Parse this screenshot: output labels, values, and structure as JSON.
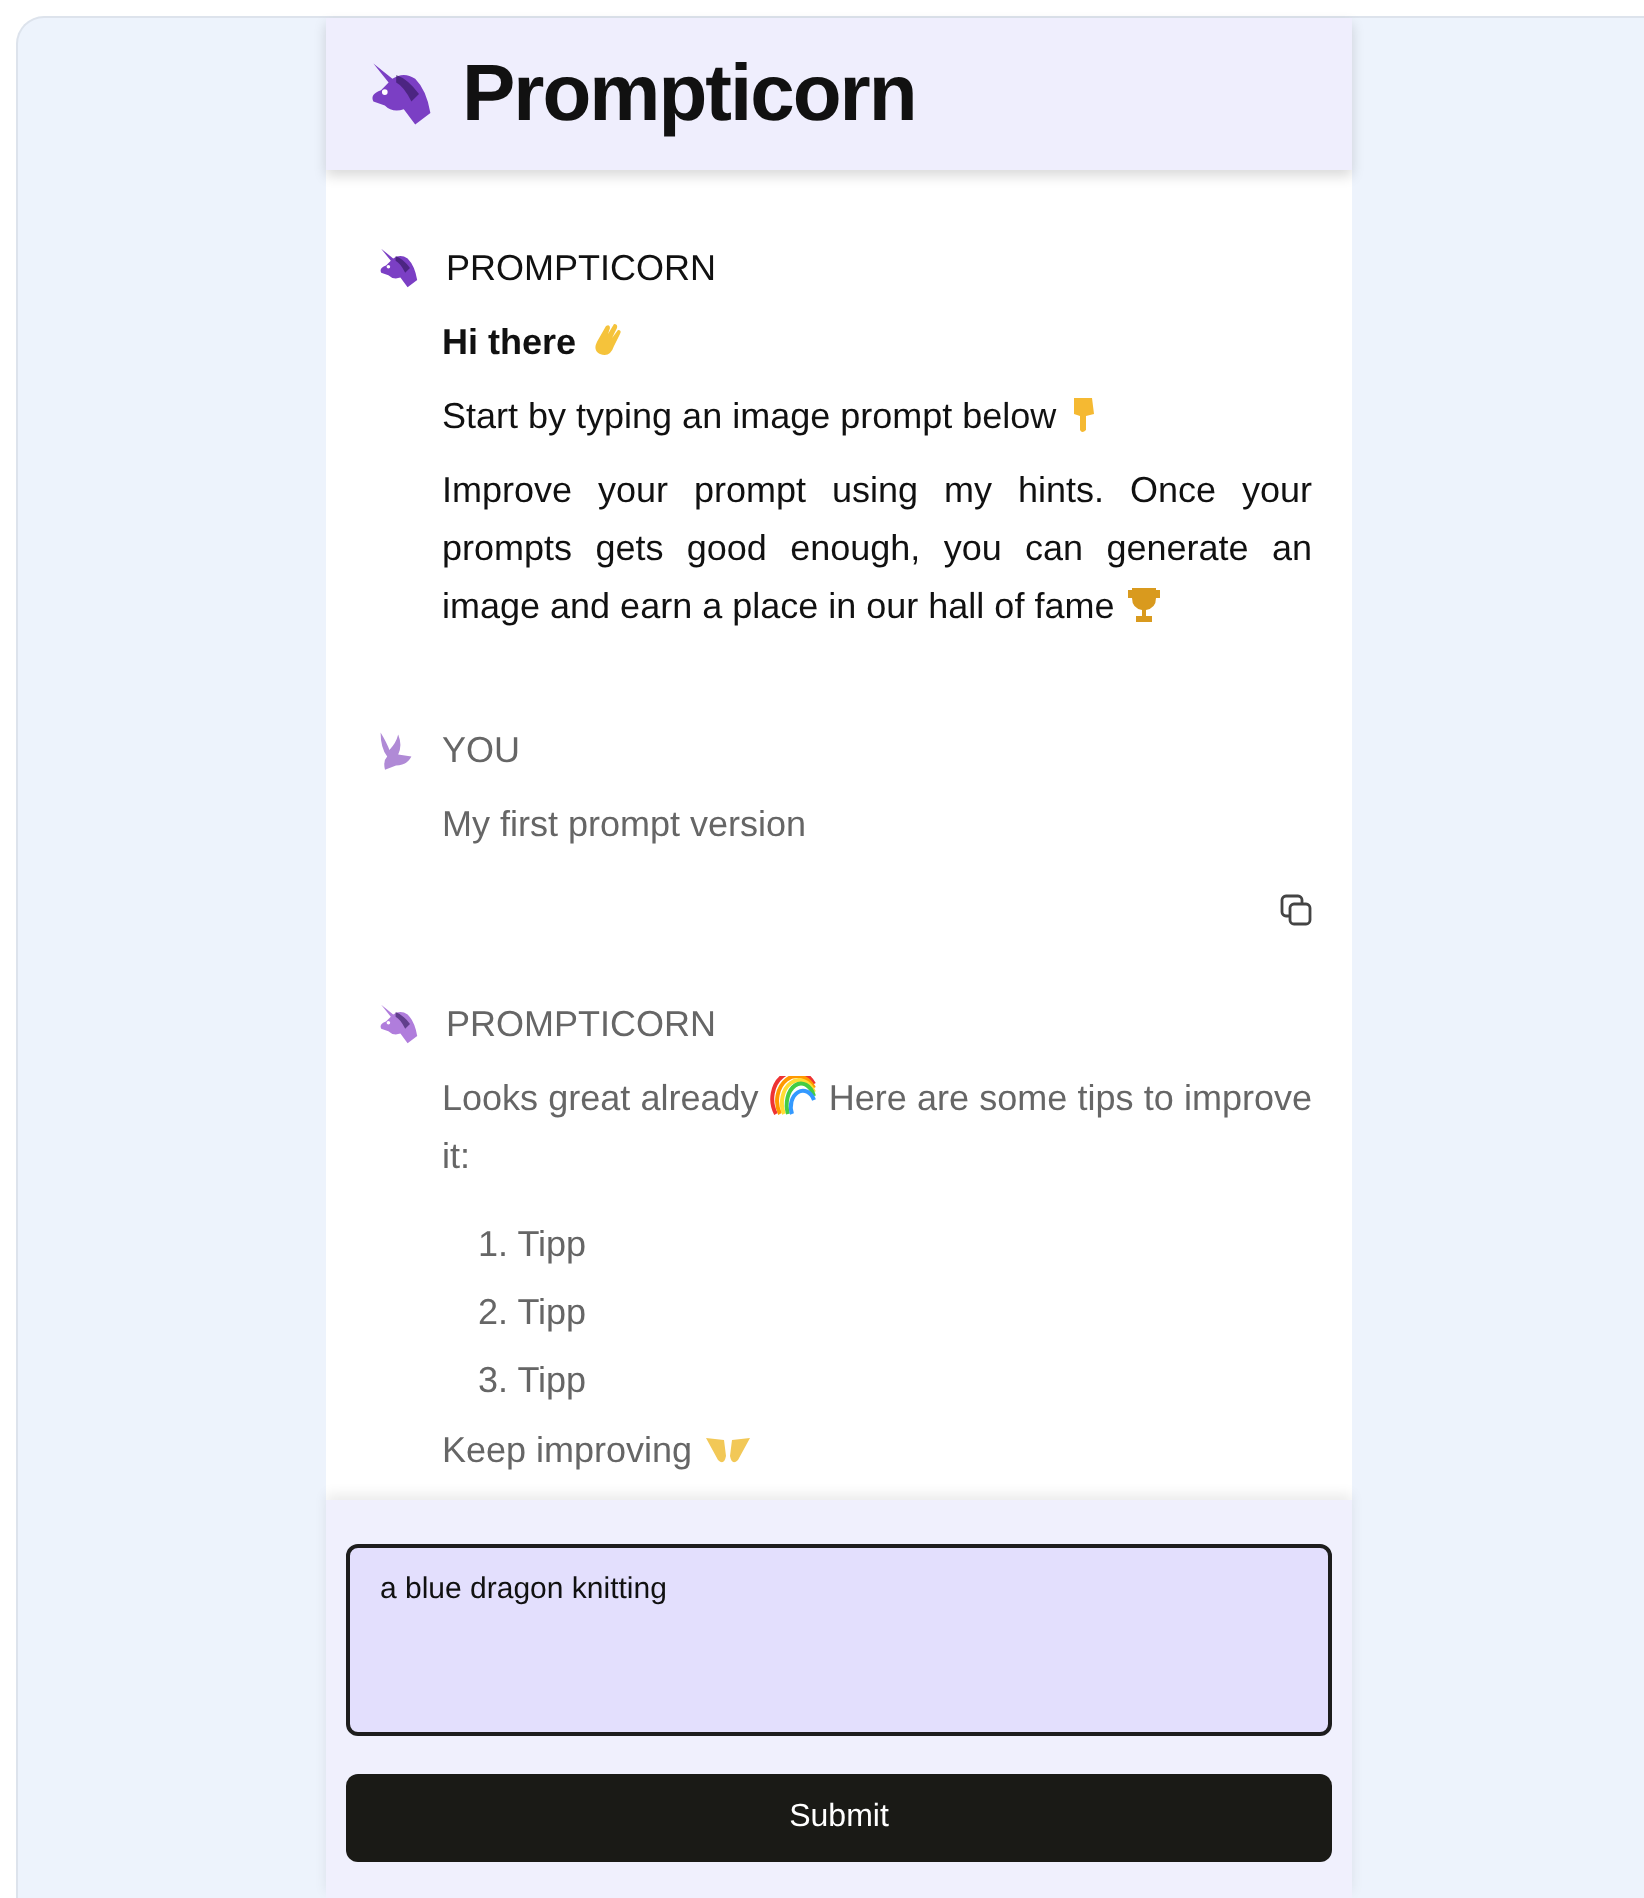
{
  "app": {
    "title": "Prompticorn"
  },
  "messages": [
    {
      "sender": "PROMPTICORN",
      "kind": "bot",
      "faded": false,
      "copyable": false,
      "paragraphs": [
        {
          "text": "Hi there",
          "bold": true,
          "kind": "greeting"
        },
        {
          "text": "Start by typing an image prompt below",
          "bold": false,
          "kind": "instruction"
        },
        {
          "text": "Improve your prompt using my hints. Once your prompts gets good enough, you can generate an image and earn a place in our hall of fame",
          "bold": false,
          "kind": "goal"
        }
      ]
    },
    {
      "sender": "YOU",
      "kind": "user",
      "faded": true,
      "copyable": true,
      "paragraphs": [
        {
          "text": "My first prompt version",
          "bold": false,
          "kind": "plain"
        }
      ]
    },
    {
      "sender": "PROMPTICORN",
      "kind": "bot",
      "faded": true,
      "copyable": false,
      "paragraphs": [
        {
          "text": "Looks great already",
          "bold": false,
          "kind": "praise",
          "after_icon": "Here are some tips to improve it:"
        }
      ],
      "tips": [
        "1. Tipp",
        "2. Tipp",
        "3. Tipp"
      ],
      "closing": {
        "text": "Keep improving",
        "kind": "encourage"
      }
    }
  ],
  "composer": {
    "value": "a blue dragon knitting",
    "button": "Submit"
  }
}
